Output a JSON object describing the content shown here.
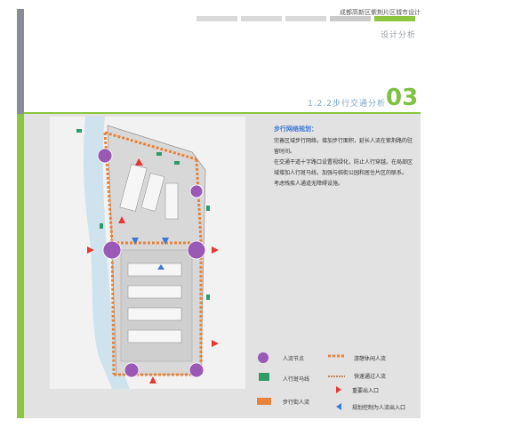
{
  "header": {
    "project": "成都高新区紫荆片区城市设计",
    "subtitle": "设计分析",
    "section_title": "1.2.2步行交通分析",
    "section_number": "03"
  },
  "description": {
    "title": "步行网络规划：",
    "lines": [
      "完善区域步行网络，增加步行面积，延长人流在紫荆路的驻留时间。",
      "在交通干道十字路口设置视绿化，防止人行穿越。在局部区域增加人行斑马线，加强与临街公园和居住片区的联系。",
      "考虑残疾人通道无障碍设施。"
    ]
  },
  "legend": [
    {
      "icon": "crowd-node-icon",
      "label": "人流节点"
    },
    {
      "icon": "tourist-flow-icon",
      "label": "游憩休闲人流"
    },
    {
      "icon": "zebra-crossing-icon",
      "label": "人行斑马线"
    },
    {
      "icon": "fast-pass-flow-icon",
      "label": "快速通过人流"
    },
    {
      "icon": "pedestrian-street-flow-icon",
      "label": "步行街人流"
    },
    {
      "icon": "main-entrance-icon",
      "label": "重要出入口"
    },
    {
      "icon": "planned-control-icon",
      "label": "规划控制为人流出入口"
    }
  ],
  "colors": {
    "accent_green": "#7dc242",
    "gray_bar": "#8a8d95",
    "blue_title": "#3c78d8"
  }
}
